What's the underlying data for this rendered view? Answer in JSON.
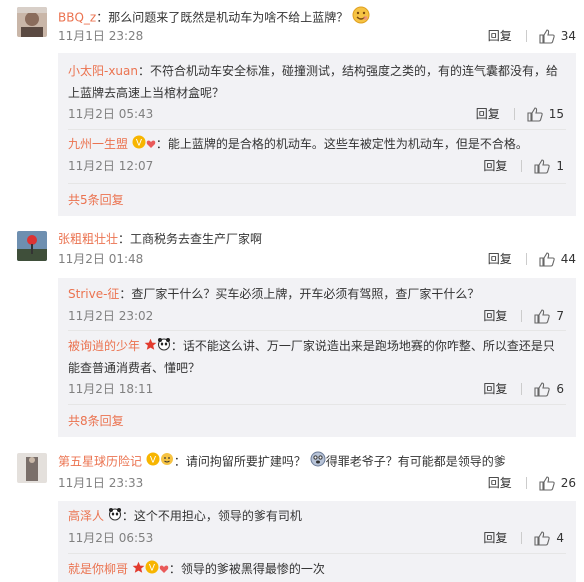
{
  "threads": [
    {
      "user": "BBQ_z",
      "sep": "：",
      "text": "那么问题来了既然是机动车为啥不给上蓝牌？",
      "time": "11月1日 23:28",
      "reply": "回复",
      "likes": "34",
      "subs": [
        {
          "user": "小太阳-xuan",
          "sep": "：",
          "line1": "不符合机动车安全标准，碰撞测试，结构强度之类的，有的连气囊都没有，给",
          "line2": "上蓝牌去高速上当棺材盒呢？",
          "time": "11月2日 05:43",
          "reply": "回复",
          "likes": "15"
        },
        {
          "user": "九州一生盟",
          "sep": "：",
          "line1": "能上蓝牌的是合格的机动车。这些车被定性为机动车，但是不合格。",
          "time": "11月2日 12:07",
          "reply": "回复",
          "likes": "1"
        }
      ],
      "more": "共5条回复"
    },
    {
      "user": "张粗粗壮壮",
      "sep": "：",
      "text": "工商税务去查生产厂家啊",
      "time": "11月2日 01:48",
      "reply": "回复",
      "likes": "44",
      "subs": [
        {
          "user": "Strive-征",
          "sep": "：",
          "line1": "查厂家干什么？买车必须上牌，开车必须有驾照，查厂家干什么？",
          "time": "11月2日 23:02",
          "reply": "回复",
          "likes": "7"
        },
        {
          "user": "被询逍的少年",
          "sep": "：",
          "line1": "话不能这么讲、万一厂家说造出来是跑场地赛的你咋整、所以查还是只",
          "line2": "能查普通消费者、懂吧？",
          "time": "11月2日 18:11",
          "reply": "回复",
          "likes": "6"
        }
      ],
      "more": "共8条回复"
    },
    {
      "user": "第五星球历险记",
      "sep": "：",
      "text": "请问拘留所要扩建吗？",
      "text2": "得罪老爷子？有可能都是领导的爹",
      "time": "11月1日 23:33",
      "reply": "回复",
      "likes": "26",
      "subs": [
        {
          "user": "高泽人",
          "sep": "：",
          "line1": "这个不用担心，领导的爹有司机",
          "time": "11月2日 06:53",
          "reply": "回复",
          "likes": "4"
        },
        {
          "user": "就是你柳哥",
          "sep": "：",
          "line1": "领导的爹被黑得最惨的一次"
        }
      ]
    }
  ],
  "colors": {
    "username": "#eb7350",
    "subbox": "#f2f2f5",
    "meta": "#808080"
  }
}
